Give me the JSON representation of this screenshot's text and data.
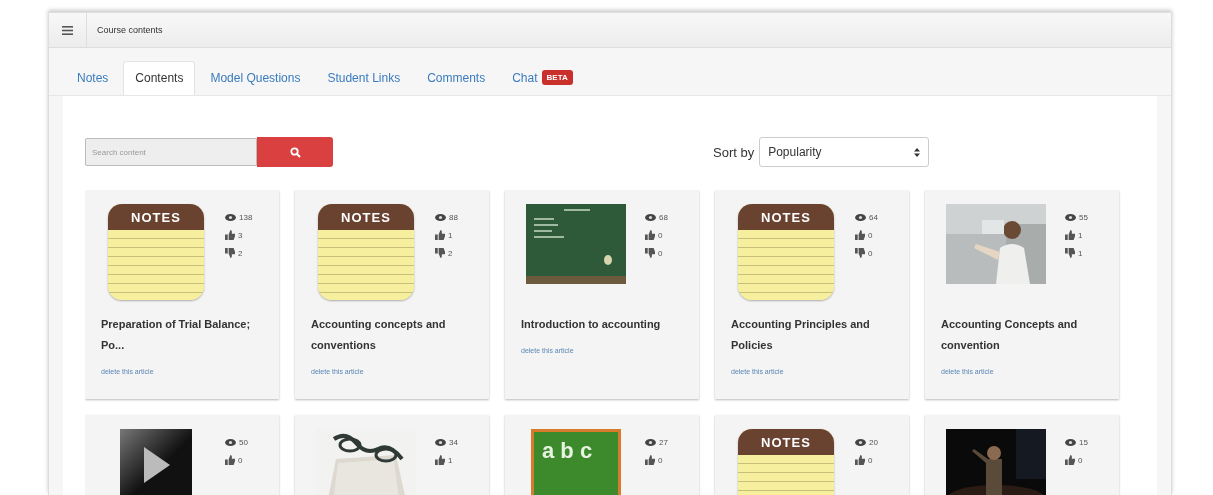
{
  "header": {
    "title": "Course contents"
  },
  "tabs": [
    {
      "label": "Notes",
      "selected": false
    },
    {
      "label": "Contents",
      "selected": true
    },
    {
      "label": "Model Questions",
      "selected": false
    },
    {
      "label": "Student Links",
      "selected": false
    },
    {
      "label": "Comments",
      "selected": false
    },
    {
      "label": "Chat",
      "selected": false,
      "badge": "BETA"
    }
  ],
  "search": {
    "placeholder": "Search content"
  },
  "sort": {
    "label": "Sort by",
    "value": "Popularity"
  },
  "cards": [
    {
      "thumb": {
        "kind": "notes",
        "label": "NOTES"
      },
      "views": "138",
      "likes": "3",
      "dislikes": "2",
      "title": "Preparation of Trial Balance; Po...",
      "link": "delete this article"
    },
    {
      "thumb": {
        "kind": "notes",
        "label": "NOTES"
      },
      "views": "88",
      "likes": "1",
      "dislikes": "2",
      "title": "Accounting concepts and conventions",
      "link": "delete this article"
    },
    {
      "views": "68",
      "likes": "0",
      "dislikes": "0",
      "title": "Introduction to accounting",
      "link": "delete this article"
    },
    {
      "thumb": {
        "kind": "notes",
        "label": "NOTES"
      },
      "views": "64",
      "likes": "0",
      "dislikes": "0",
      "title": "Accounting Principles and Policies",
      "link": "delete this article"
    },
    {
      "views": "55",
      "likes": "1",
      "dislikes": "1",
      "title": "Accounting Concepts and convention",
      "link": "delete this article"
    },
    {
      "thumb": {
        "kind": "video"
      },
      "views": "50",
      "likes": "0"
    },
    {
      "views": "34",
      "likes": "1"
    },
    {
      "thumb": {
        "kind": "letters",
        "label": "a b c"
      },
      "views": "27",
      "likes": "0"
    },
    {
      "thumb": {
        "kind": "notes",
        "label": "NOTES"
      },
      "views": "20",
      "likes": "0"
    },
    {
      "views": "15",
      "likes": "0"
    }
  ]
}
